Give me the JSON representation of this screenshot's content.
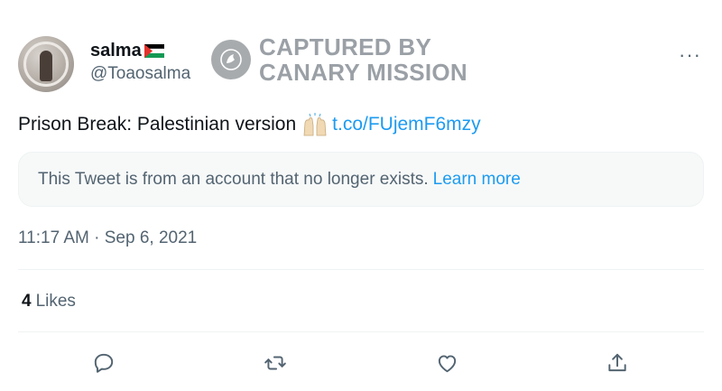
{
  "author": {
    "display_name": "salma",
    "handle": "@Toaosalma",
    "flag_icon": "palestine-flag-icon"
  },
  "watermark": {
    "line1": "CAPTURED BY",
    "line2": "CANARY MISSION",
    "logo_icon": "canary-bird-icon"
  },
  "menu": {
    "label": "···"
  },
  "tweet": {
    "text": "Prison Break: Palestinian version",
    "emoji_icon": "raising-hands-emoji",
    "link": "t.co/FUjemF6mzy"
  },
  "notice": {
    "text": "This Tweet is from an account that no longer exists.",
    "learn_more": "Learn more"
  },
  "timestamp": "11:17 AM · Sep 6, 2021",
  "stats": {
    "likes_count": "4",
    "likes_label": "Likes"
  },
  "actions": [
    {
      "icon": "reply-icon"
    },
    {
      "icon": "retweet-icon"
    },
    {
      "icon": "like-icon"
    },
    {
      "icon": "share-icon"
    }
  ],
  "colors": {
    "link": "#1d9bf0",
    "secondary_text": "#536471",
    "primary_text": "#0f1419",
    "watermark": "#9aa0a6"
  }
}
